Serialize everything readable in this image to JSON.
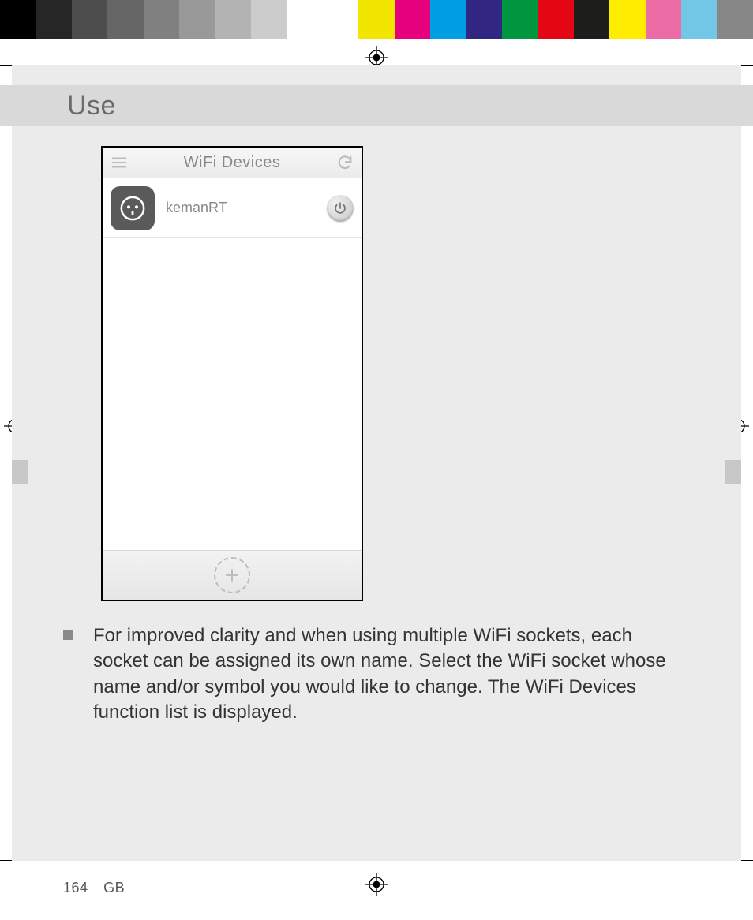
{
  "section_title": "Use",
  "phone": {
    "screen_title": "WiFi Devices",
    "device_name": "kemanRT"
  },
  "bullet_text": "For improved clarity and when using multiple WiFi sockets, each socket can be assigned its own name. Select the WiFi socket whose name and/or symbol you would like to change. The WiFi Devices function list is displayed.",
  "footer": {
    "page_number": "164",
    "region": "GB"
  }
}
